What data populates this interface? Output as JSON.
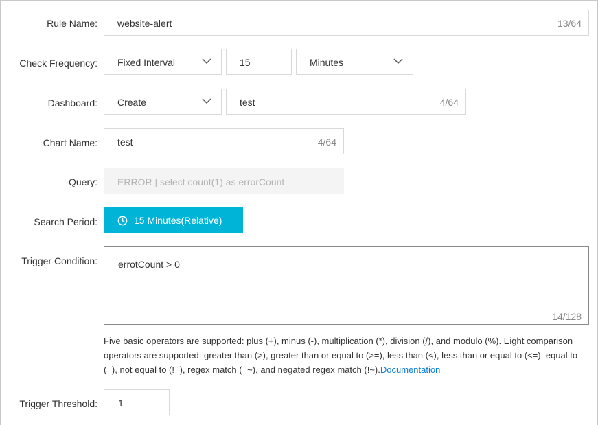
{
  "form": {
    "rule_name": {
      "label": "Rule Name:",
      "value": "website-alert",
      "count": "13/64"
    },
    "check_frequency": {
      "label": "Check Frequency:",
      "mode": "Fixed Interval",
      "interval": "15",
      "unit": "Minutes"
    },
    "dashboard": {
      "label": "Dashboard:",
      "mode": "Create",
      "value": "test",
      "count": "4/64"
    },
    "chart_name": {
      "label": "Chart Name:",
      "value": "test",
      "count": "4/64"
    },
    "query": {
      "label": "Query:",
      "value": "ERROR | select count(1) as errorCount"
    },
    "search_period": {
      "label": "Search Period:",
      "button_label": "15 Minutes(Relative)"
    },
    "trigger_condition": {
      "label": "Trigger Condition:",
      "value": "errotCount > 0",
      "count": "14/128",
      "help_text": "Five basic operators are supported: plus (+), minus (-), multiplication (*), division (/), and modulo (%). Eight comparison operators are supported: greater than (>), greater than or equal to (>=), less than (<), less than or equal to (<=), equal to (=), not equal to (!=), regex match (=~), and negated regex match (!~).",
      "help_link": "Documentation"
    },
    "trigger_threshold": {
      "label": "Trigger Threshold:",
      "value": "1"
    }
  },
  "colors": {
    "accent": "#00b4d8",
    "link": "#0a7fd6",
    "border": "#d9d9d9"
  },
  "icons": {
    "select_arrow": "chevron-down-icon",
    "period": "clock-icon"
  }
}
